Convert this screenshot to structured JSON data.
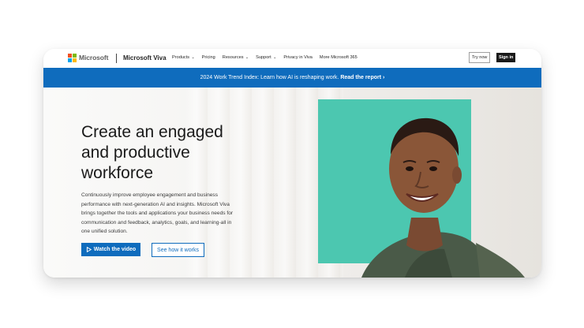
{
  "nav": {
    "brand": "Microsoft",
    "product": "Microsoft Viva",
    "links": [
      {
        "label": "Products",
        "has_dropdown": true
      },
      {
        "label": "Pricing",
        "has_dropdown": false
      },
      {
        "label": "Resources",
        "has_dropdown": true
      },
      {
        "label": "Support",
        "has_dropdown": true
      },
      {
        "label": "Privacy in Viva",
        "has_dropdown": false
      },
      {
        "label": "More Microsoft 365",
        "has_dropdown": false
      }
    ],
    "try_label": "Try now",
    "signin_label": "Sign in"
  },
  "banner": {
    "text": "2024 Work Trend Index: Learn how AI is reshaping work.",
    "link": "Read the report"
  },
  "hero": {
    "headline": "Create an engaged and productive workforce",
    "body": "Continuously improve employee engagement and business performance with next-generation AI and insights. Microsoft Viva brings together the tools and applications your business needs for communication and feedback, analytics, goals, and learning-all in one unified solution.",
    "primary_cta": "Watch the video",
    "secondary_cta": "See how it works"
  },
  "colors": {
    "accent": "#0f6cbd",
    "photo_background": "#4cc7b0",
    "logo": [
      "#f25022",
      "#7fba00",
      "#00a4ef",
      "#ffb900"
    ]
  },
  "icons": {
    "play": "play-icon",
    "chevron": "chevron-right-icon"
  }
}
